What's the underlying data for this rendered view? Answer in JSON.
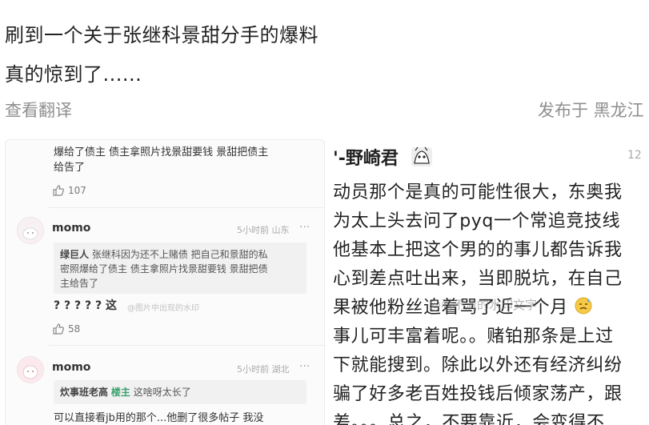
{
  "post": {
    "line1": "刷到一个关于张继科景甜分手的爆料",
    "line2": "真的惊到了......",
    "translate_label": "查看翻译",
    "published_label": "发布于 黑龙江"
  },
  "left_screenshot": {
    "top_comment": {
      "text_line1": "爆给了债主 债主拿照片找景甜要钱 景甜把债主",
      "text_line2": "给告了",
      "likes": "107"
    },
    "comments": [
      {
        "username": "momo",
        "meta": "5小时前 山东",
        "more": "···",
        "quote_name": "绿巨人",
        "quote_line1": "张继科因为还不上赌债 把自己和景甜的私",
        "quote_line2": "密照爆给了债主 债主拿照片找景甜要钱 景甜把债",
        "quote_line3": "主给告了",
        "reply": "? ? ? ? ? 这",
        "reply_watermark": "@图片中出现的水印",
        "likes": "58"
      },
      {
        "username": "momo",
        "meta": "5小时前 湖北",
        "more": "···",
        "quote_name": "炊事班老高",
        "quote_badge": "楼主",
        "quote_line1": "这啥呀太长了",
        "reply": "可以直接看jb用的那个...他删了很多帖子 我没"
      }
    ]
  },
  "right_screenshot": {
    "author": "'-野崎君",
    "time": "12",
    "lines": [
      "动员那个是真的可能性很大，东奥我",
      "为太上头去问了pyq一个常追竞技线",
      "他基本上把这个男的的事儿都告诉我",
      "心到差点吐出来，当即脱坑，在自己",
      "果被他粉丝追着骂了近一个月",
      "事儿可丰富着呢。。赌铂那条是上过",
      "下就能搜到。除此以外还有经济纠纷",
      "骗了好多老百姓投钱后倾家荡产，跟",
      "差。。。总之，不要靠近，会变得不"
    ],
    "watermark": "@看不清的水印文字"
  },
  "colors": {
    "green_badge": "#3aa36b",
    "muted": "#8f8f8f"
  },
  "icons": {
    "like": "thumbs-up-icon",
    "more": "more-dots-icon",
    "avatar": "avatar-icon",
    "author_avatar": "cartoon-avatar-icon",
    "emoji": "sweat-emoji-icon"
  }
}
